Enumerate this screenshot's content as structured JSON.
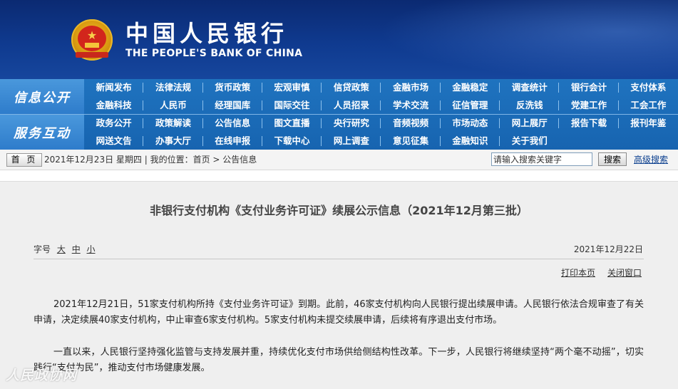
{
  "header": {
    "site_name_cn": "中国人民银行",
    "site_name_en": "THE PEOPLE'S BANK OF CHINA"
  },
  "nav": {
    "section1": "信息公开",
    "section2": "服务互动",
    "rows": [
      [
        "新闻发布",
        "法律法规",
        "货币政策",
        "宏观审慎",
        "信贷政策",
        "金融市场",
        "金融稳定",
        "调查统计",
        "银行会计",
        "支付体系"
      ],
      [
        "金融科技",
        "人民币",
        "经理国库",
        "国际交往",
        "人员招录",
        "学术交流",
        "征信管理",
        "反洗钱",
        "党建工作",
        "工会工作"
      ],
      [
        "政务公开",
        "政策解读",
        "公告信息",
        "图文直播",
        "央行研究",
        "音频视频",
        "市场动态",
        "网上展厅",
        "报告下载",
        "报刊年鉴"
      ],
      [
        "网送文告",
        "办事大厅",
        "在线申报",
        "下载中心",
        "网上调查",
        "意见征集",
        "金融知识",
        "关于我们"
      ]
    ]
  },
  "breadcrumb": {
    "home_label": "首 页",
    "date_text": "2021年12月23日  星期四",
    "location_text": "我的位置：首页  >  公告信息",
    "search_placeholder": "请输入搜索关键字",
    "search_button": "搜索",
    "advanced_search": "高级搜索"
  },
  "article": {
    "title": "非银行支付机构《支付业务许可证》续展公示信息（2021年12月第三批）",
    "font_size_label": "字号",
    "font_large": "大",
    "font_medium": "中",
    "font_small": "小",
    "date": "2021年12月22日",
    "print_label": "打印本页",
    "close_label": "关闭窗口",
    "paragraph1": "2021年12月21日，51家支付机构所持《支付业务许可证》到期。此前，46家支付机构向人民银行提出续展申请。人民银行依法合规审查了有关申请，决定续展40家支付机构，中止审查6家支付机构。5家支付机构未提交续展申请，后续将有序退出支付市场。",
    "paragraph2": "一直以来，人民银行坚持强化监管与支持发展并重，持续优化支付市场供给侧结构性改革。下一步，人民银行将继续坚持“两个毫不动摇”，切实践行“支付为民”，推动支付市场健康发展。"
  },
  "watermark": "人民政协网"
}
